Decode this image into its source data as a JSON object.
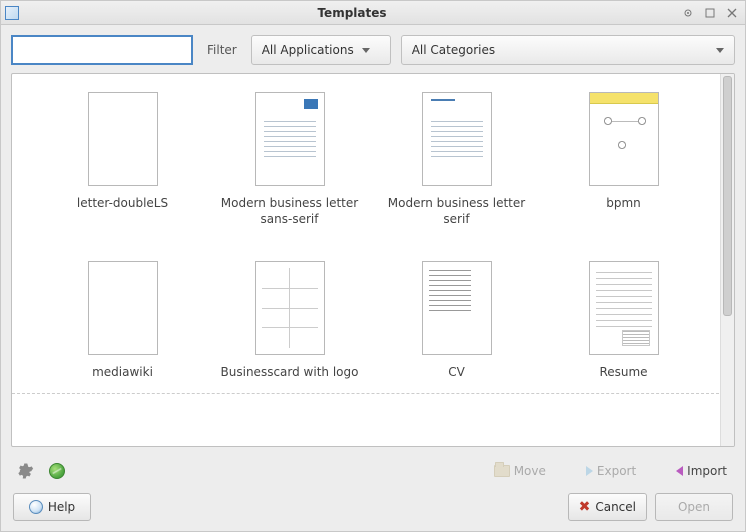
{
  "title": "Templates",
  "filter_label": "Filter",
  "dropdown_apps": "All Applications",
  "dropdown_cats": "All Categories",
  "templates": [
    {
      "name": "letter-doubleLS"
    },
    {
      "name": "Modern business letter sans-serif"
    },
    {
      "name": "Modern business letter serif"
    },
    {
      "name": "bpmn"
    },
    {
      "name": "mediawiki"
    },
    {
      "name": "Businesscard with logo"
    },
    {
      "name": "CV"
    },
    {
      "name": "Resume"
    }
  ],
  "actions": {
    "move": "Move",
    "export": "Export",
    "import": "Import"
  },
  "buttons": {
    "help": "Help",
    "cancel": "Cancel",
    "open": "Open"
  }
}
